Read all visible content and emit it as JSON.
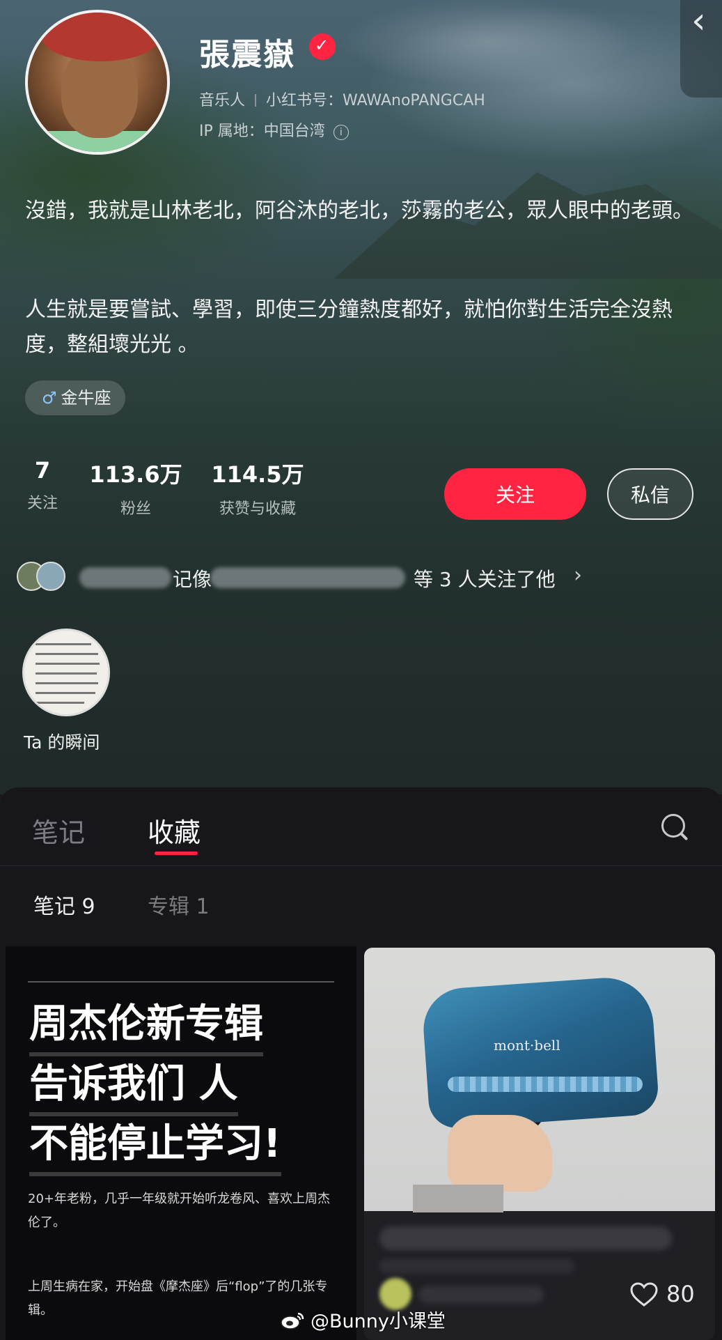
{
  "profile": {
    "name": "張震嶽",
    "verified_glyph": "✓",
    "role": "音乐人",
    "xhs_id_label": "小红书号：",
    "xhs_id": "WAWAnoPANGCAH",
    "ip_label": "IP 属地：",
    "ip_location": "中国台湾",
    "info_glyph": "i",
    "bio_line1": "沒錯，我就是山林老北，阿谷沐的老北，莎霧的老公，眾人眼中的老頭。",
    "bio_line2": "人生就是要嘗試、學習，即使三分鐘熱度都好，就怕你對生活完全沒熱度，整組壞光光 。",
    "zodiac_glyph": "♂",
    "zodiac": "金牛座"
  },
  "stats": [
    {
      "num": "7",
      "label": "关注"
    },
    {
      "num": "113.6万",
      "label": "粉丝"
    },
    {
      "num": "114.5万",
      "label": "获赞与收藏"
    }
  ],
  "actions": {
    "follow": "关注",
    "message": "私信",
    "back_glyph": "‹"
  },
  "mutual": {
    "fragment": "记像",
    "text": "等 3 人关注了他",
    "chevron": "›"
  },
  "moments": {
    "label": "Ta 的瞬间"
  },
  "tabs": {
    "notes": "笔记",
    "saved": "收藏",
    "active": "收藏"
  },
  "subtabs": {
    "notes": "笔记 9",
    "album": "专辑 1"
  },
  "cards": {
    "left": {
      "headline": [
        "周杰伦新专辑",
        "告诉我们 人",
        "不能停止学习!"
      ],
      "para1": "20+年老粉，几乎一年级就开始听龙卷风、喜欢上周杰伦了。",
      "para2": "上周生病在家，开始盘《摩杰座》后“flop”了的几张专辑。"
    },
    "right": {
      "photo_brand": "mont·bell",
      "likes": "80"
    }
  },
  "watermark": "@Bunny小课堂",
  "colors": {
    "accent": "#ff2442",
    "panel": "#17171b"
  }
}
